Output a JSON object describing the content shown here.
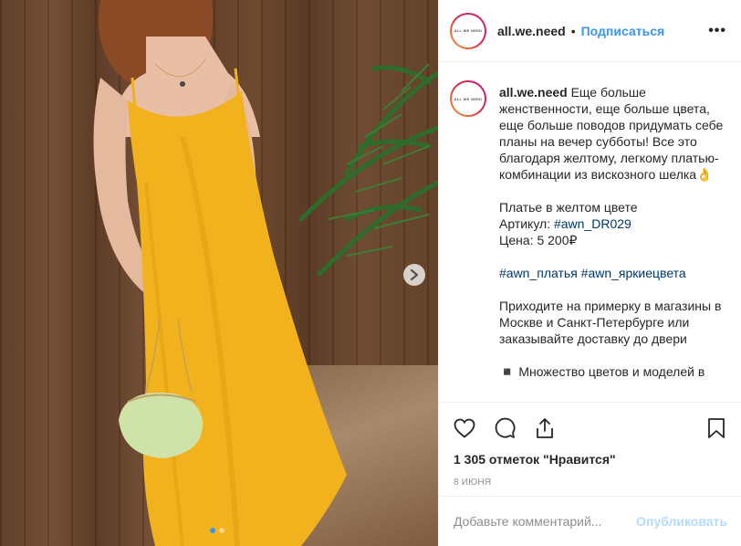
{
  "post": {
    "account": {
      "username": "all.we.need",
      "avatar_text": "ALL WE NEED",
      "separator": "•",
      "follow_label": "Подписаться",
      "more_label": "•••"
    },
    "caption": {
      "username": "all.we.need",
      "lines": [
        "Еще больше женственности, еще больше цвета, еще больше поводов придумать себе планы на вечер субботы! Все это благодаря желтому, легкому платью-комбинации из вискозного шелка👌"
      ],
      "product_name": "Платье в желтом цвете",
      "article_label": "Артикул:",
      "article_tag": "#awn_DR029",
      "price": "Цена: 5 200₽",
      "tag1": "#awn_платья",
      "tag2": "#awn_яркиецвета",
      "visit_text": "Приходите на примерку в магазины в Москве и Санкт-Петербурге или заказывайте доставку до двери",
      "bullet_icon": "◾",
      "bullet_text": "Множество цветов и моделей в"
    },
    "likes": "1 305 отметок \"Нравится\"",
    "date": "8 июня",
    "comment_placeholder": "Добавьте комментарий...",
    "publish_label": "Опубликовать",
    "carousel": {
      "total": 2,
      "active": 1
    },
    "colors": {
      "accent": "#3897f0",
      "publish_disabled": "#b3dbff",
      "dress": "#f4b41a"
    }
  }
}
